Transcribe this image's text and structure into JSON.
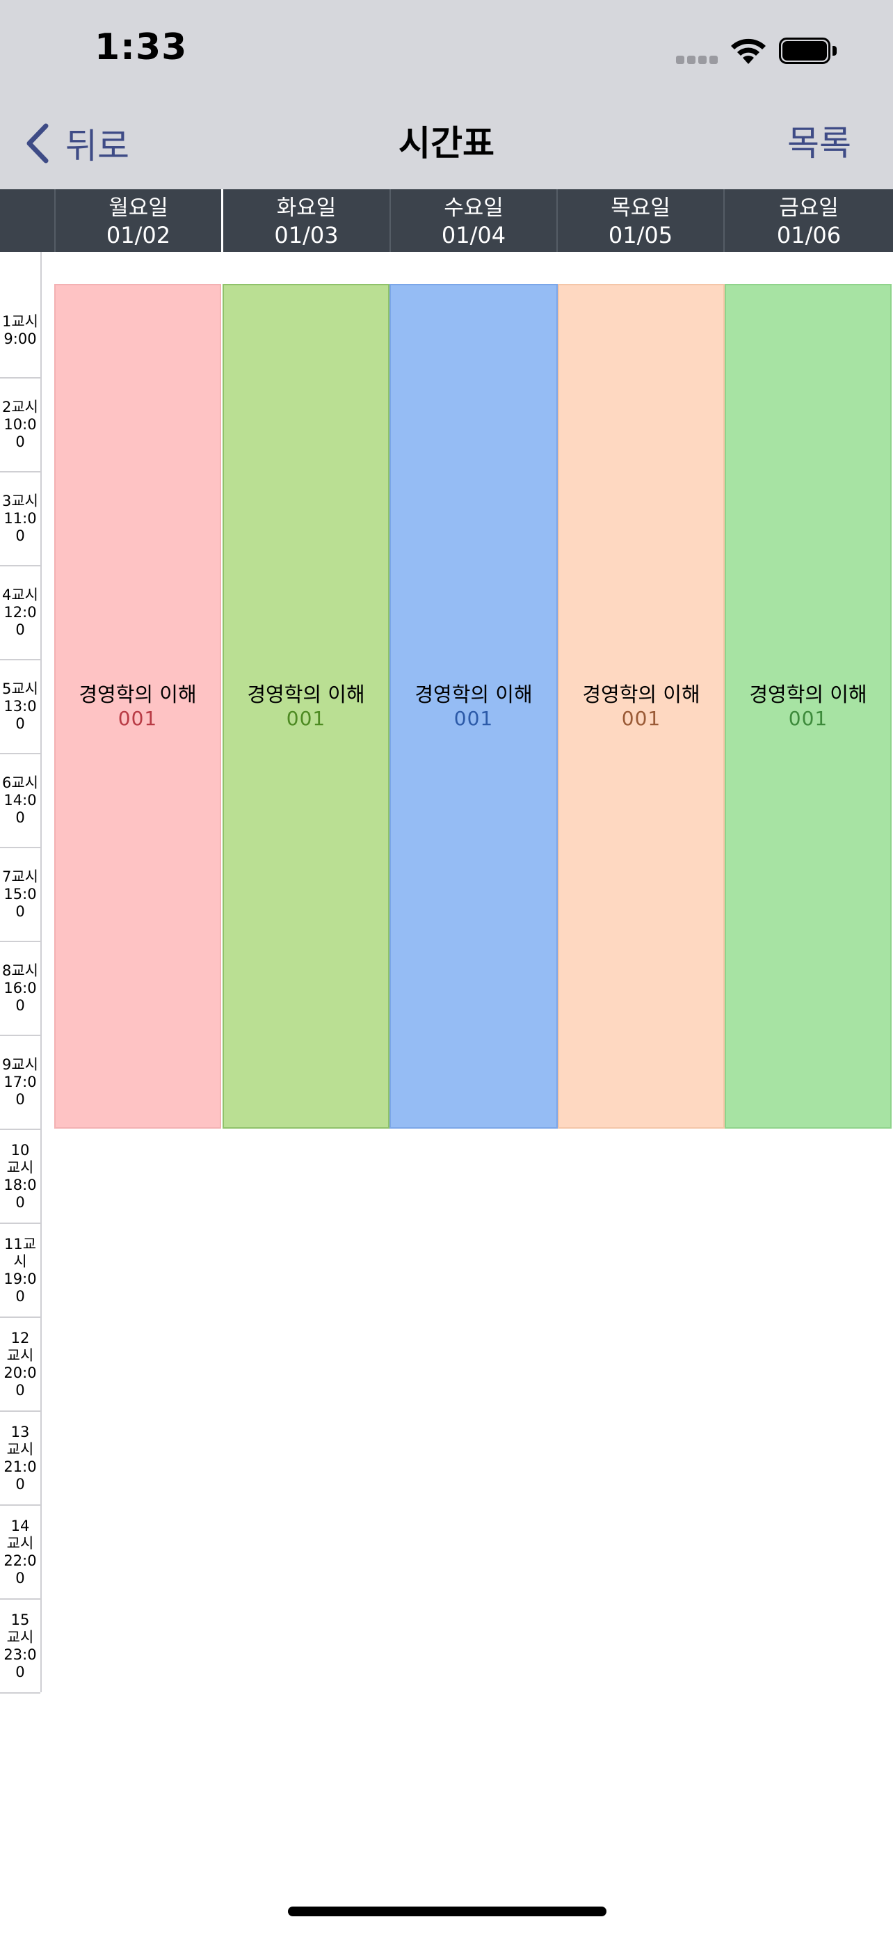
{
  "status_bar": {
    "time": "1:33"
  },
  "nav": {
    "back_label": "뒤로",
    "title": "시간표",
    "list_label": "목록"
  },
  "days": [
    {
      "name": "월요일",
      "date": "01/02"
    },
    {
      "name": "화요일",
      "date": "01/03"
    },
    {
      "name": "수요일",
      "date": "01/04"
    },
    {
      "name": "목요일",
      "date": "01/05"
    },
    {
      "name": "금요일",
      "date": "01/06"
    }
  ],
  "periods": [
    {
      "label": "1교시\n9:00"
    },
    {
      "label": "2교시\n10:00"
    },
    {
      "label": "3교시\n11:00"
    },
    {
      "label": "4교시\n12:00"
    },
    {
      "label": "5교시\n13:00"
    },
    {
      "label": "6교시\n14:00"
    },
    {
      "label": "7교시\n15:00"
    },
    {
      "label": "8교시\n16:00"
    },
    {
      "label": "9교시\n17:00"
    },
    {
      "label": "10\n교시\n18:00"
    },
    {
      "label": "11교시\n19:00"
    },
    {
      "label": "12\n교시\n20:0\n0"
    },
    {
      "label": "13\n교시\n21:00"
    },
    {
      "label": "14\n교시\n22:0\n0"
    },
    {
      "label": "15\n교시\n23:0\n0"
    }
  ],
  "classes": [
    {
      "name": "경영학의 이해",
      "code": "001",
      "bg": "#fec3c4",
      "border": "#f3b1b3",
      "code_color": "#b83a44"
    },
    {
      "name": "경영학의 이해",
      "code": "001",
      "bg": "#badf93",
      "border": "#8fc26a",
      "code_color": "#4d8a22"
    },
    {
      "name": "경영학의 이해",
      "code": "001",
      "bg": "#95bcf4",
      "border": "#7ba6e8",
      "code_color": "#2c5aa8"
    },
    {
      "name": "경영학의 이해",
      "code": "001",
      "bg": "#fed8c1",
      "border": "#f4c6a8",
      "code_color": "#9a5a36"
    },
    {
      "name": "경영학의 이해",
      "code": "001",
      "bg": "#a7e3a3",
      "border": "#8fd38b",
      "code_color": "#3d8a3b"
    }
  ],
  "colors": {
    "accent": "#3e4b86",
    "header_bg": "#3c434c",
    "nav_bg": "#d6d7dc"
  }
}
